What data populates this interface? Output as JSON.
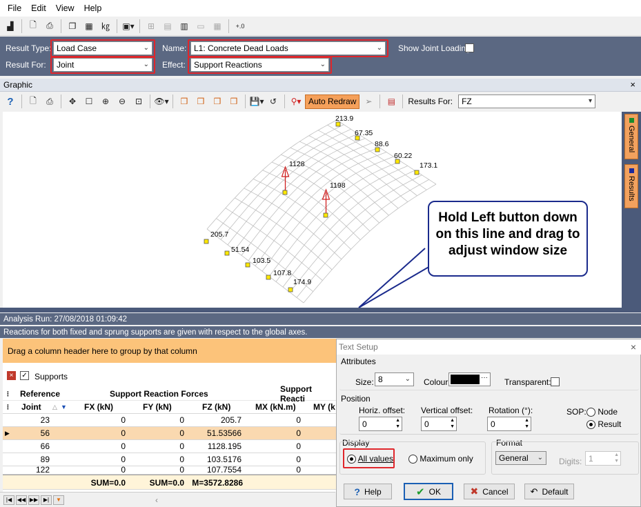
{
  "menu": [
    "File",
    "Edit",
    "View",
    "Help"
  ],
  "settings": {
    "result_type_label": "Result Type:",
    "result_type_value": "Load Case",
    "result_for_label": "Result For:",
    "result_for_value": "Joint",
    "name_label": "Name:",
    "name_value": "L1: Concrete Dead Loads",
    "effect_label": "Effect:",
    "effect_value": "Support Reactions",
    "show_joint_loading": "Show Joint Loading"
  },
  "graphic": {
    "title": "Graphic",
    "close": "×",
    "auto_redraw": "Auto Redraw",
    "results_for_label": "Results For:",
    "results_for_value": "FZ",
    "side_tabs": [
      "General",
      "Results"
    ],
    "labels": [
      "213.9",
      "67.35",
      "88.6",
      "60.22",
      "173.1",
      "1128",
      "1198",
      "205.7",
      "51.54",
      "103.5",
      "107.8",
      "174.9"
    ],
    "callout": "Hold Left button down on this line and drag to adjust window size"
  },
  "analysis": {
    "run": "Analysis Run: 27/08/2018 01:09:42",
    "note": "Reactions for both fixed and sprung supports are given with respect to the global axes."
  },
  "grid": {
    "group_hint": "Drag a column header here to group by that column",
    "supports_label": "Supports",
    "header_reference": "Reference",
    "header_reaction_forces": "Support Reaction Forces",
    "header_reaction_moments": "Support Reacti",
    "columns": [
      "Joint",
      "FX (kN)",
      "FY (kN)",
      "FZ (kN)",
      "MX (kN.m)",
      "MY (k"
    ],
    "rows": [
      [
        "23",
        "0",
        "0",
        "205.7",
        "0"
      ],
      [
        "56",
        "0",
        "0",
        "51.53566",
        "0"
      ],
      [
        "66",
        "0",
        "0",
        "1128.195",
        "0"
      ],
      [
        "89",
        "0",
        "0",
        "103.5176",
        "0"
      ],
      [
        "122",
        "0",
        "0",
        "107.7554",
        "0"
      ]
    ],
    "footer": [
      "SUM=0.0",
      "SUM=0.0",
      "M=3572.8286"
    ]
  },
  "dialog": {
    "title": "Text Setup",
    "close": "×",
    "attributes_label": "Attributes",
    "size_label": "Size:",
    "size_value": "8",
    "colour_label": "Colour",
    "colour_value": "#000000",
    "transparent_label": "Transparent:",
    "position_label": "Position",
    "horiz_offset_label": "Horiz. offset:",
    "horiz_offset_value": "0",
    "vert_offset_label": "Vertical offset:",
    "vert_offset_value": "0",
    "rotation_label": "Rotation (°):",
    "rotation_value": "0",
    "sop_label": "SOP:",
    "sop_node": "Node",
    "sop_result": "Result",
    "display_label": "Display",
    "all_values": "All values",
    "max_only": "Maximum only",
    "format_label": "Format",
    "format_value": "General",
    "digits_label": "Digits:",
    "digits_value": "1",
    "help_btn": "Help",
    "ok_btn": "OK",
    "cancel_btn": "Cancel",
    "default_btn": "Default"
  },
  "colors": {
    "settings_bg": "#5b6882",
    "highlight_red": "#e0262b",
    "orange": "#f5a05a",
    "selected_row": "#fad9b0"
  }
}
